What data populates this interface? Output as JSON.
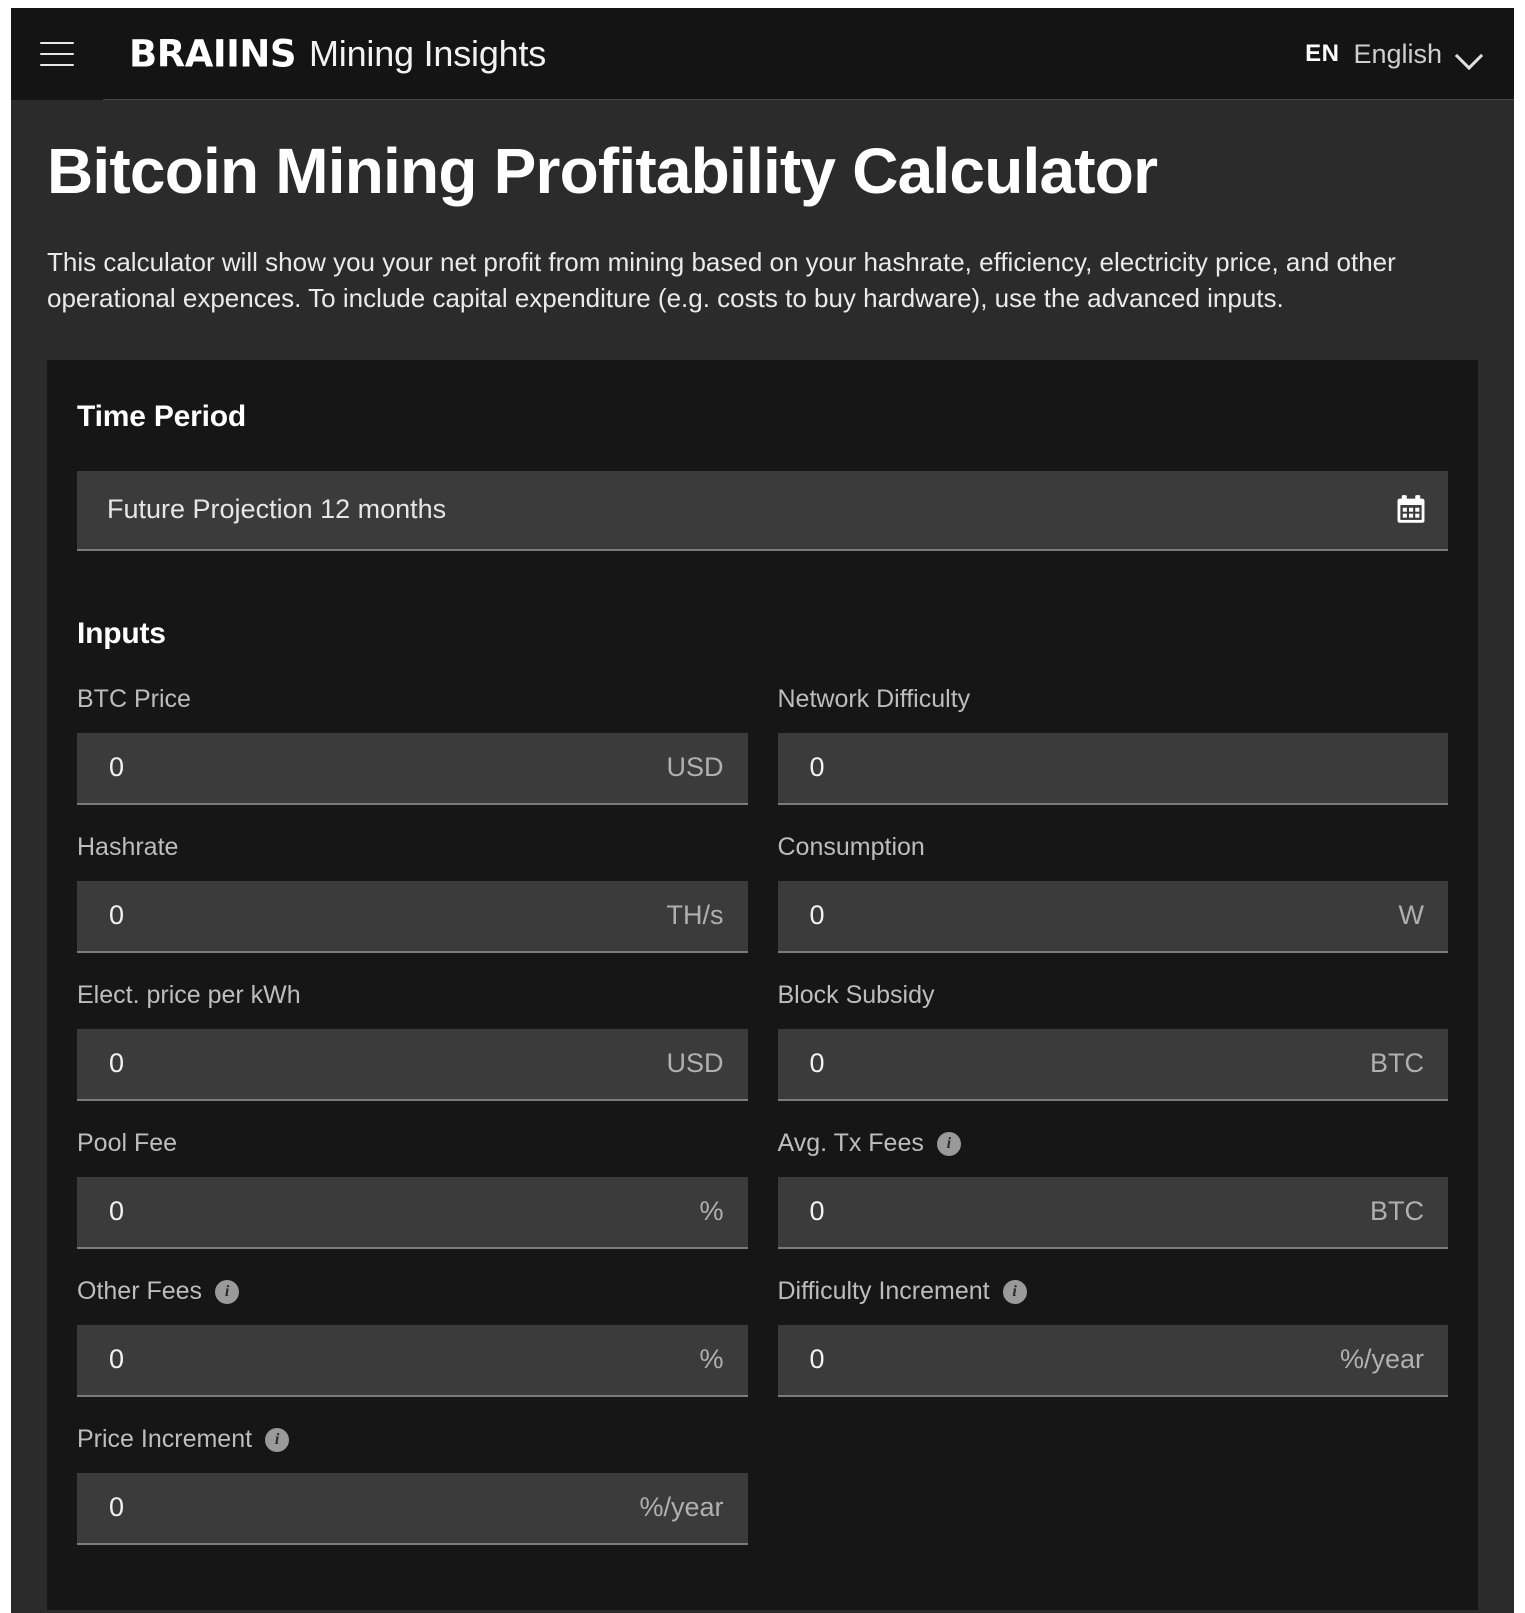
{
  "header": {
    "menu_icon": "hamburger-menu-icon",
    "brand_mark": "BRAIINS",
    "brand_sub": "Mining Insights",
    "language_code": "EN",
    "language_name": "English",
    "chevron_icon": "chevron-down-icon"
  },
  "page": {
    "title": "Bitcoin Mining Profitability Calculator",
    "description": "This calculator will show you your net profit from mining based on your hashrate, efficiency, electricity price, and other operational expences. To include capital expenditure (e.g. costs to buy hardware), use the advanced inputs."
  },
  "time_period": {
    "section_title": "Time Period",
    "value": "Future Projection 12 months",
    "calendar_icon": "calendar-icon"
  },
  "inputs": {
    "section_title": "Inputs",
    "fields": [
      {
        "label": "BTC Price",
        "value": "0",
        "unit": "USD",
        "info": false,
        "column": "left"
      },
      {
        "label": "Network Difficulty",
        "value": "0",
        "unit": "",
        "info": false,
        "column": "right"
      },
      {
        "label": "Hashrate",
        "value": "0",
        "unit": "TH/s",
        "info": false,
        "column": "left"
      },
      {
        "label": "Consumption",
        "value": "0",
        "unit": "W",
        "info": false,
        "column": "right"
      },
      {
        "label": "Elect. price per kWh",
        "value": "0",
        "unit": "USD",
        "info": false,
        "column": "left"
      },
      {
        "label": "Block Subsidy",
        "value": "0",
        "unit": "BTC",
        "info": false,
        "column": "right"
      },
      {
        "label": "Pool Fee",
        "value": "0",
        "unit": "%",
        "info": false,
        "column": "left"
      },
      {
        "label": "Avg. Tx Fees",
        "value": "0",
        "unit": "BTC",
        "info": true,
        "column": "right"
      },
      {
        "label": "Other Fees",
        "value": "0",
        "unit": "%",
        "info": true,
        "column": "left"
      },
      {
        "label": "Difficulty Increment",
        "value": "0",
        "unit": "%/year",
        "info": true,
        "column": "right"
      },
      {
        "label": "Price Increment",
        "value": "0",
        "unit": "%/year",
        "info": true,
        "column": "left"
      }
    ],
    "info_icon_glyph": "i"
  },
  "colors": {
    "page_bg": "#2b2b2b",
    "header_bg": "#141414",
    "card_bg": "#161616",
    "input_bg": "#3b3b3b",
    "input_underline": "#7a7a7a",
    "text_primary": "#ffffff",
    "text_muted": "#bdbdbd"
  }
}
